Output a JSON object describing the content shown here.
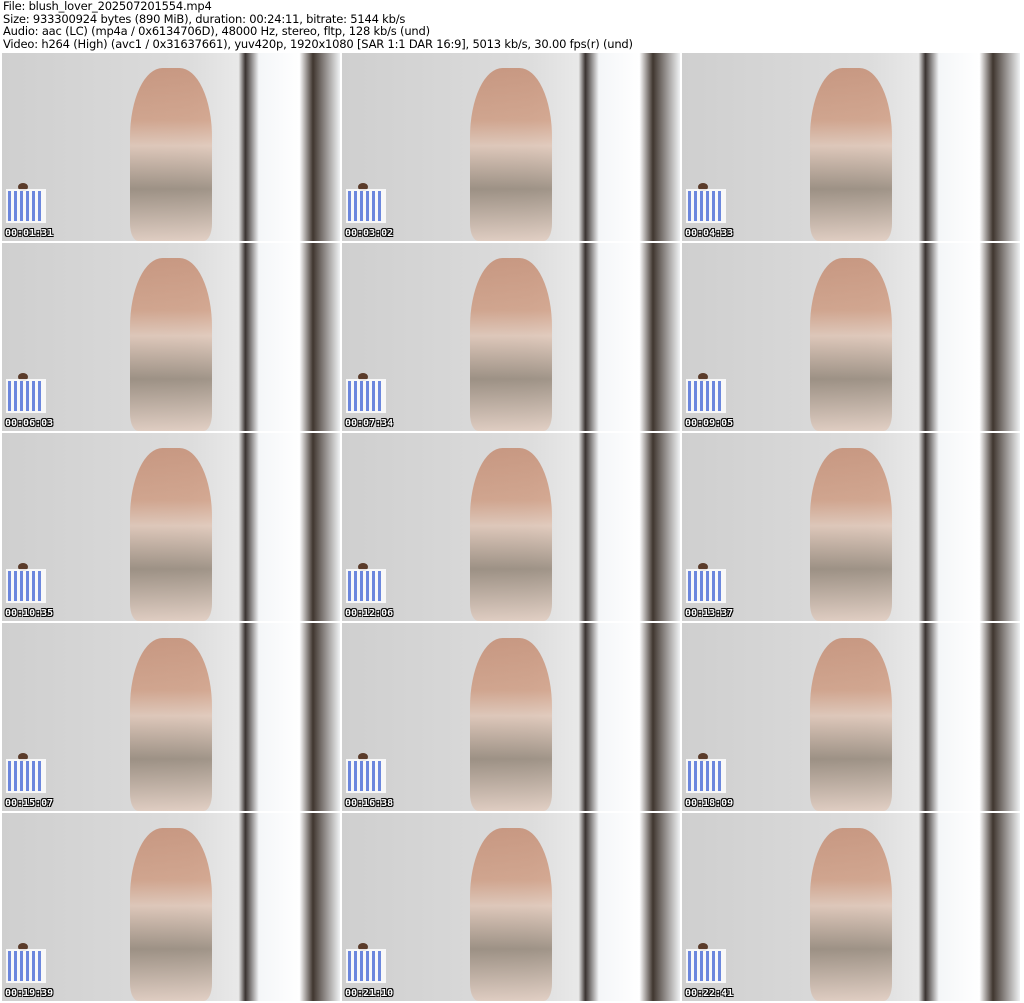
{
  "header": {
    "file": "File: blush_lover_202507201554.mp4",
    "size": "Size: 933300924 bytes (890 MiB), duration: 00:24:11, bitrate: 5144 kb/s",
    "audio": "Audio: aac (LC) (mp4a / 0x6134706D), 48000 Hz, stereo, fltp, 128 kb/s (und)",
    "video": "Video: h264 (High) (avc1 / 0x31637661), yuv420p, 1920x1080 [SAR 1:1 DAR 16:9], 5013 kb/s, 30.00 fps(r) (und)"
  },
  "thumbnails": [
    {
      "timestamp": "00:01:31"
    },
    {
      "timestamp": "00:03:02"
    },
    {
      "timestamp": "00:04:33"
    },
    {
      "timestamp": "00:06:03"
    },
    {
      "timestamp": "00:07:34"
    },
    {
      "timestamp": "00:09:05"
    },
    {
      "timestamp": "00:10:35"
    },
    {
      "timestamp": "00:12:06"
    },
    {
      "timestamp": "00:13:37"
    },
    {
      "timestamp": "00:15:07"
    },
    {
      "timestamp": "00:16:38"
    },
    {
      "timestamp": "00:18:09"
    },
    {
      "timestamp": "00:19:39"
    },
    {
      "timestamp": "00:21:10"
    },
    {
      "timestamp": "00:22:41"
    }
  ]
}
